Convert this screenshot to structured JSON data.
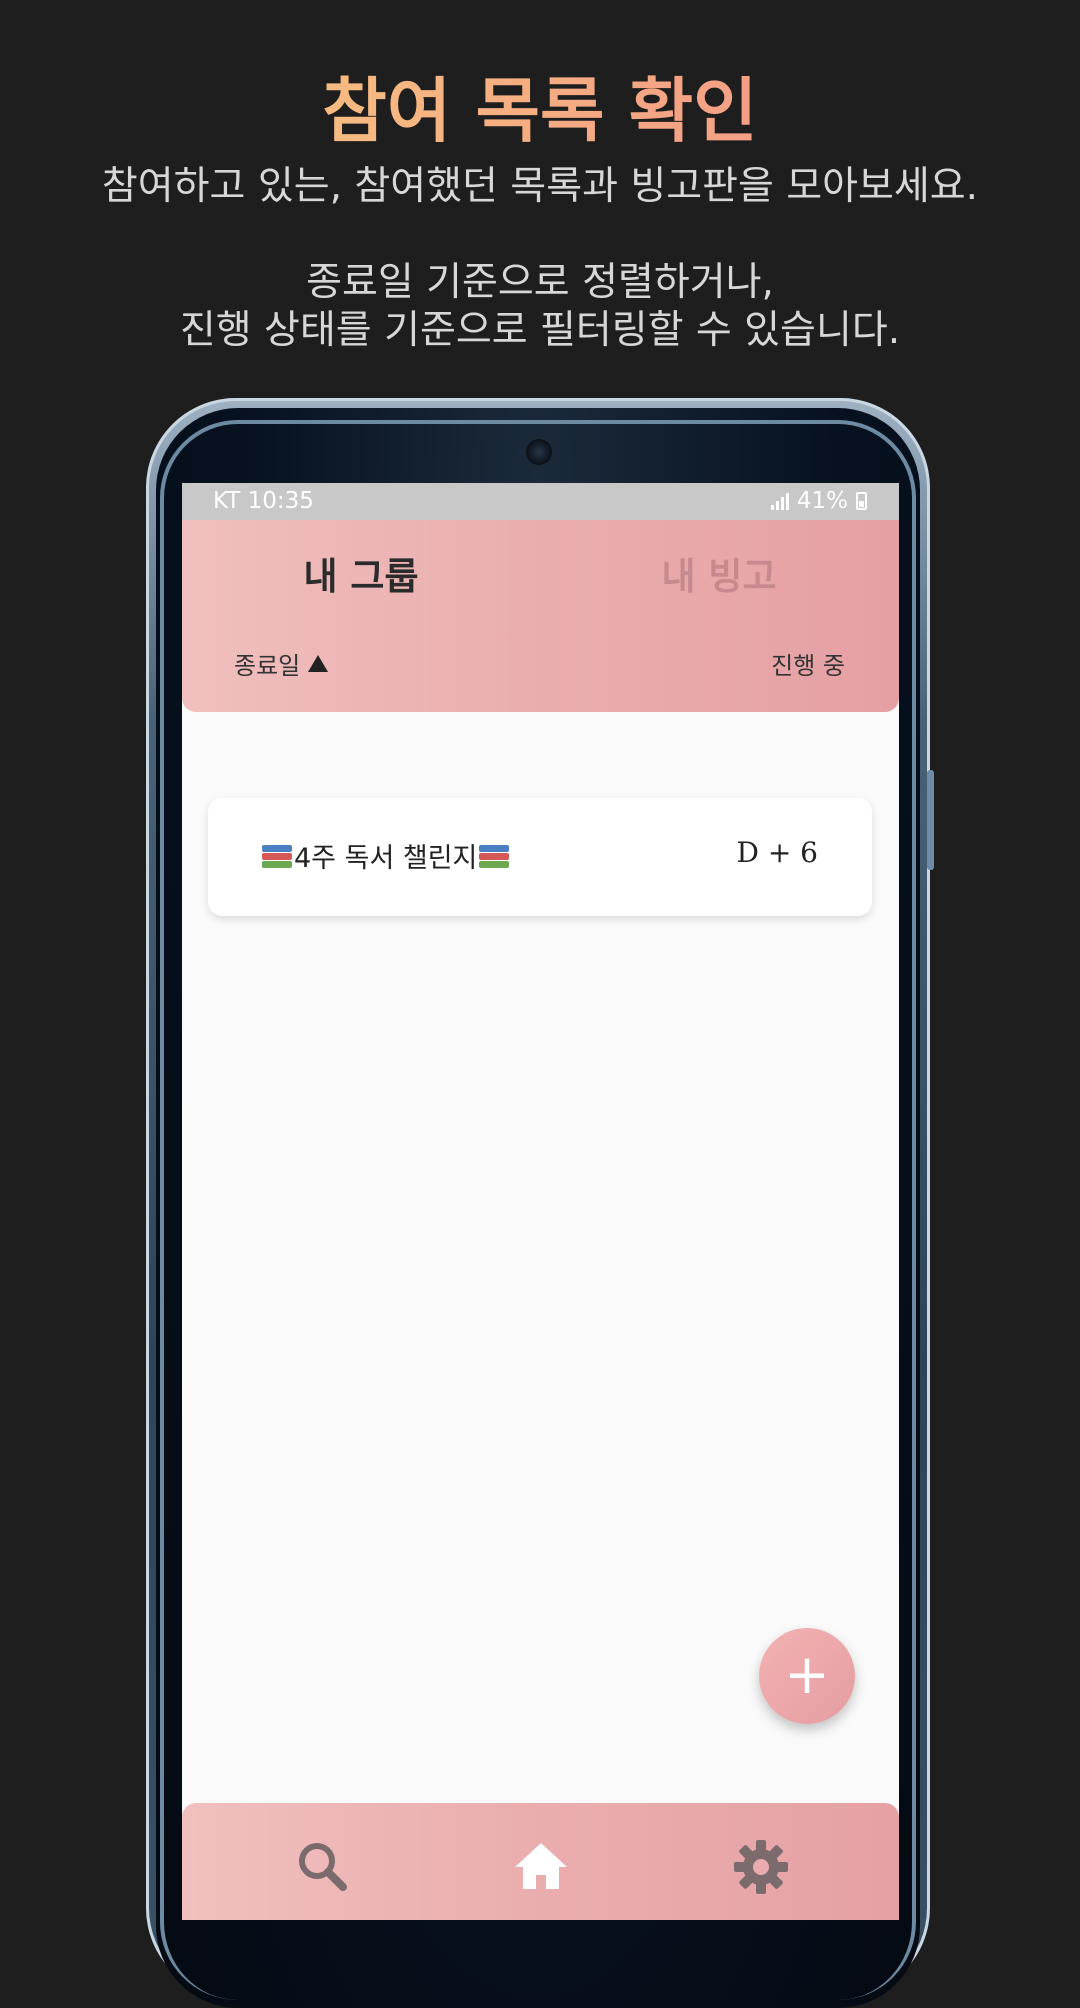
{
  "promo": {
    "title": "참여 목록 확인",
    "line1": "참여하고 있는, 참여했던 목록과 빙고판을 모아보세요.",
    "line2": "종료일 기준으로 정렬하거나,",
    "line3": "진행 상태를 기준으로 필터링할 수 있습니다."
  },
  "status_bar": {
    "carrier_time": "KT 10:35",
    "battery": "41%"
  },
  "tabs": [
    {
      "label": "내 그룹",
      "active": true
    },
    {
      "label": "내 빙고",
      "active": false
    }
  ],
  "sort": {
    "label": "종료일",
    "direction": "ascending"
  },
  "filter": {
    "label": "진행 중"
  },
  "groups": [
    {
      "name": "4주 독서 챌린지",
      "dday": "D + 6",
      "icon": "books-icon"
    }
  ],
  "fab": {
    "label": "+"
  },
  "bottom_nav": [
    {
      "name": "search",
      "icon": "search-icon"
    },
    {
      "name": "home",
      "icon": "home-icon",
      "active": true
    },
    {
      "name": "settings",
      "icon": "gear-icon"
    }
  ],
  "colors": {
    "header_start": "#f0bfbe",
    "header_end": "#e5a0a3",
    "title_gradient": [
      "#f7d27e",
      "#f5a983",
      "#f08e8c"
    ]
  }
}
